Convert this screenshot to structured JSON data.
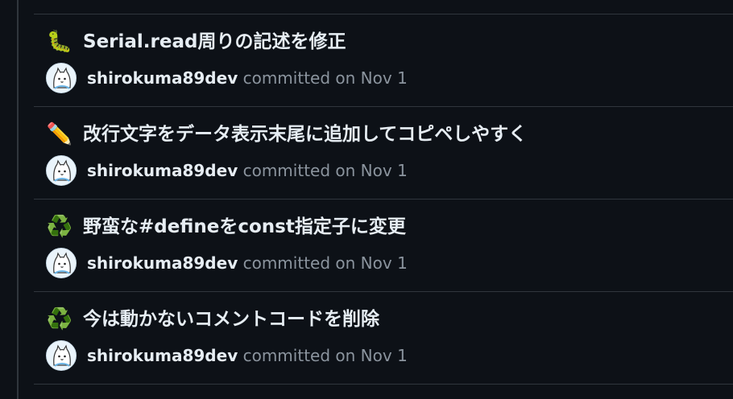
{
  "commits": [
    {
      "emoji": "🐛",
      "message": "Serial.read周りの記述を修正",
      "author": "shirokuma89dev",
      "committed_label": "committed on",
      "date": "Nov 1"
    },
    {
      "emoji": "✏️",
      "message": "改行文字をデータ表示末尾に追加してコピペしやすく",
      "author": "shirokuma89dev",
      "committed_label": "committed on",
      "date": "Nov 1"
    },
    {
      "emoji": "♻️",
      "message": "野蛮な#defineをconst指定子に変更",
      "author": "shirokuma89dev",
      "committed_label": "committed on",
      "date": "Nov 1"
    },
    {
      "emoji": "♻️",
      "message": "今は動かないコメントコードを削除",
      "author": "shirokuma89dev",
      "committed_label": "committed on",
      "date": "Nov 1"
    }
  ]
}
